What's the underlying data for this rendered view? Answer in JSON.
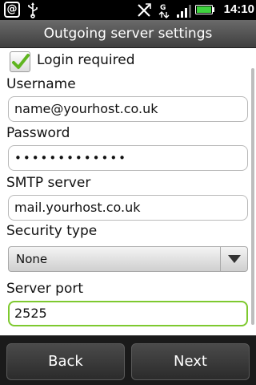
{
  "status_bar": {
    "time": "14:10",
    "icons": [
      "at-sign-icon",
      "usb-icon",
      "no-signal-icon",
      "data-transfer-icon",
      "signal-bars-icon",
      "battery-icon"
    ]
  },
  "title": "Outgoing server settings",
  "form": {
    "login_required": {
      "label": "Login required",
      "checked": true
    },
    "username": {
      "label": "Username",
      "value": "name@yourhost.co.uk"
    },
    "password": {
      "label": "Password",
      "value": "•••••••••••••"
    },
    "smtp_server": {
      "label": "SMTP server",
      "value": "mail.yourhost.co.uk"
    },
    "security_type": {
      "label": "Security type",
      "value": "None"
    },
    "server_port": {
      "label": "Server port",
      "value": "2525"
    }
  },
  "buttons": {
    "back": "Back",
    "next": "Next"
  },
  "colors": {
    "focus_border": "#7ec92f",
    "checkmark": "#5fb51f",
    "title_bar": "#555555"
  }
}
